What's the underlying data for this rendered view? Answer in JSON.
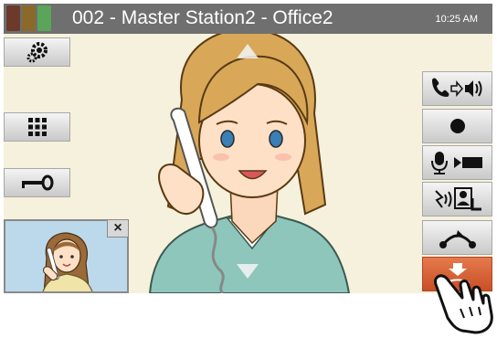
{
  "title_bar": {
    "station_title": "002 - Master Station2 - Office2",
    "time": "10:25 AM",
    "signal_colors": [
      "#6b3a2a",
      "#8a6a2a",
      "#5aa55a"
    ]
  },
  "left_toolbar": {
    "settings": {
      "icon": "gear-icon"
    },
    "keypad": {
      "icon": "keypad-icon"
    },
    "key": {
      "icon": "key-icon"
    }
  },
  "right_toolbar": {
    "call_transfer": {
      "icon": "phone-to-speaker-icon"
    },
    "record": {
      "icon": "record-icon"
    },
    "mic_video": {
      "icon": "mic-video-icon"
    },
    "scan": {
      "icon": "scan-icon"
    },
    "hold": {
      "icon": "hold-icon"
    },
    "end_call": {
      "icon": "end-call-icon",
      "color": "#d9603a"
    }
  },
  "video": {
    "pan_up_icon": "arrow-up-icon",
    "pan_down_icon": "arrow-down-icon"
  },
  "pip": {
    "close_label": "×"
  }
}
